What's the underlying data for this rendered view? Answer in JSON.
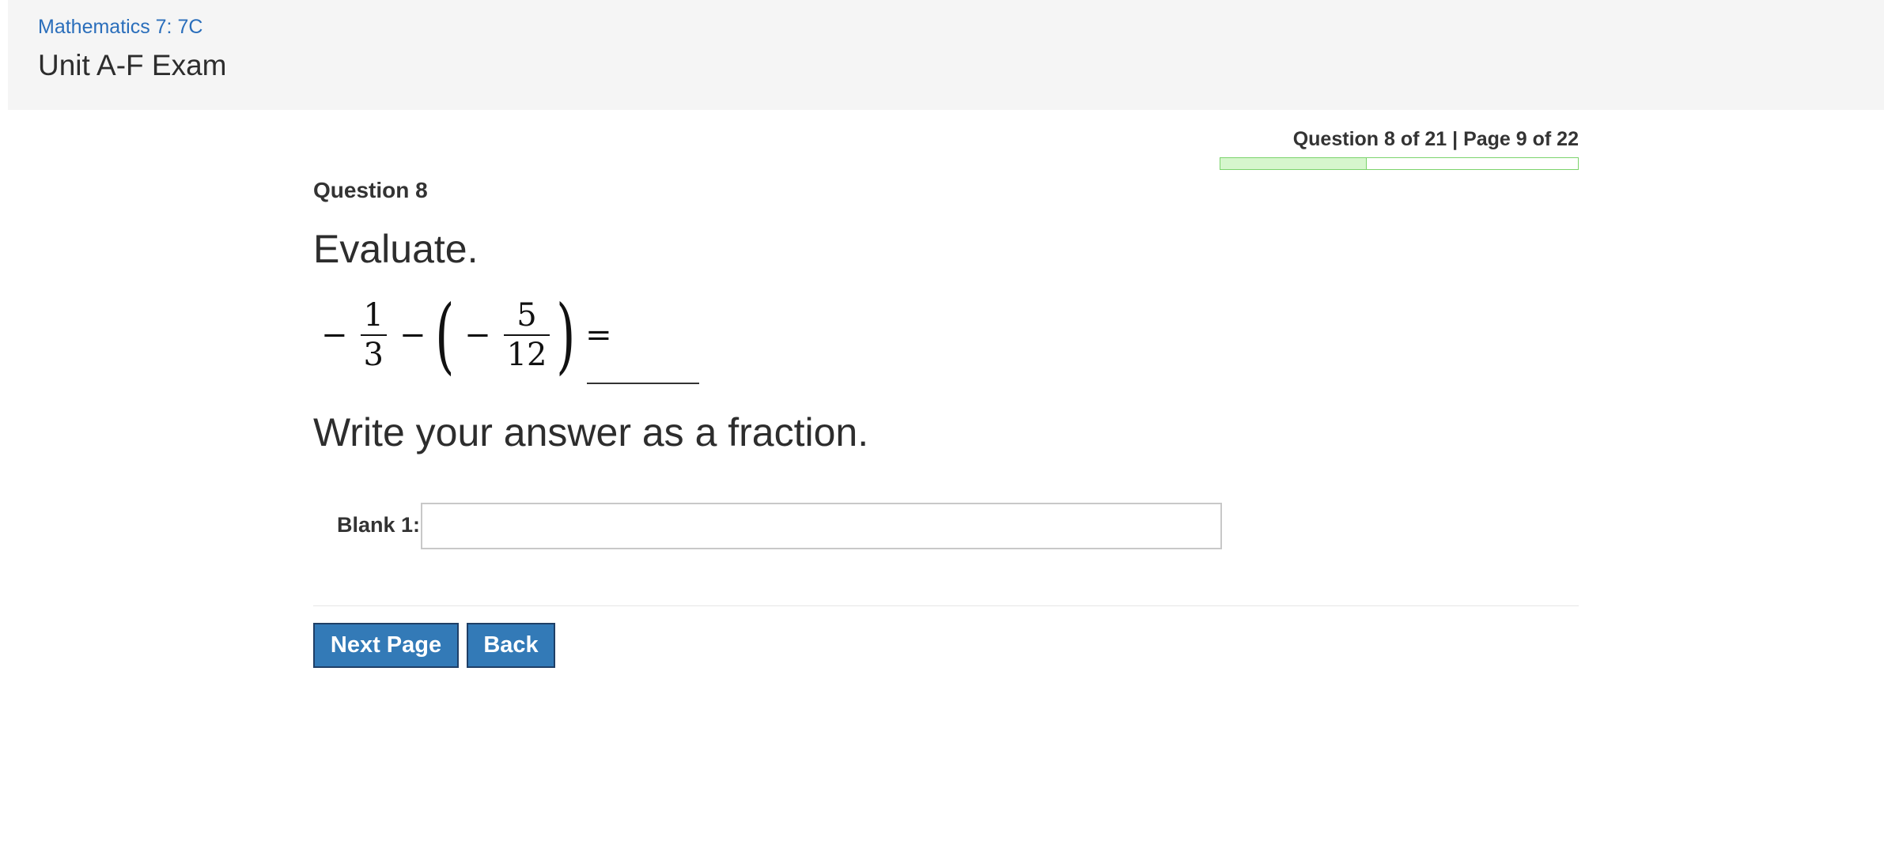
{
  "header": {
    "course": "Mathematics 7: 7C",
    "exam_title": "Unit A-F Exam"
  },
  "progress": {
    "text": "Question 8 of 21 | Page 9 of 22",
    "fraction": 0.41
  },
  "question": {
    "number_label": "Question 8",
    "prompt": "Evaluate.",
    "expression": {
      "minus1": "−",
      "frac1_num": "1",
      "frac1_den": "3",
      "minus2": "−",
      "paren_open": "(",
      "minus3": "−",
      "frac2_num": "5",
      "frac2_den": "12",
      "paren_close": ")",
      "equals": "="
    },
    "instruction": "Write your answer as a fraction."
  },
  "blank": {
    "label": "Blank 1:",
    "value": ""
  },
  "buttons": {
    "next": "Next Page",
    "back": "Back"
  }
}
